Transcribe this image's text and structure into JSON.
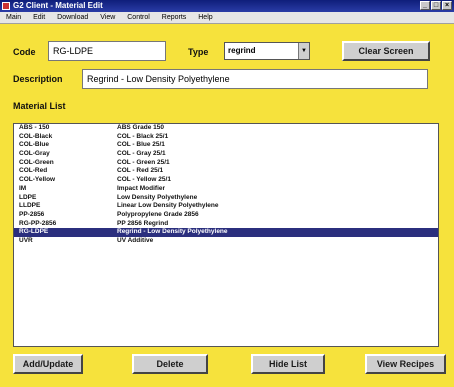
{
  "window": {
    "title": "G2 Client - Material Edit",
    "controls": [
      "_",
      "□",
      "×"
    ]
  },
  "menu": [
    "Main",
    "Edit",
    "Download",
    "View",
    "Control",
    "Reports",
    "Help"
  ],
  "form": {
    "code_label": "Code",
    "code_value": "RG-LDPE",
    "type_label": "Type",
    "type_value": "regrind",
    "clear_label": "Clear Screen",
    "description_label": "Description",
    "description_value": "Regrind - Low Density Polyethylene"
  },
  "list": {
    "heading": "Material List",
    "rows": [
      {
        "code": "ABS - 150",
        "desc": "ABS Grade 150"
      },
      {
        "code": "COL-Black",
        "desc": "COL - Black 25/1"
      },
      {
        "code": "COL-Blue",
        "desc": "COL - Blue 25/1"
      },
      {
        "code": "COL-Gray",
        "desc": "COL - Gray 25/1"
      },
      {
        "code": "COL-Green",
        "desc": "COL - Green 25/1"
      },
      {
        "code": "COL-Red",
        "desc": "COL - Red 25/1"
      },
      {
        "code": "COL-Yellow",
        "desc": "COL - Yellow 25/1"
      },
      {
        "code": "IM",
        "desc": "Impact Modifier"
      },
      {
        "code": "LDPE",
        "desc": "Low Density Polyethylene"
      },
      {
        "code": "LLDPE",
        "desc": "Linear Low Density Polyethylene"
      },
      {
        "code": "PP-2856",
        "desc": "Polypropylene Grade 2856"
      },
      {
        "code": "RG-PP-2856",
        "desc": "PP 2856 Regrind"
      },
      {
        "code": "RG-LDPE",
        "desc": "Regrind - Low Density Polyethylene",
        "selected": true
      },
      {
        "code": "UVR",
        "desc": "UV Additive"
      }
    ]
  },
  "buttons": {
    "add_update": "Add/Update",
    "delete": "Delete",
    "hide_list": "Hide List",
    "view_recipes": "View Recipes"
  }
}
